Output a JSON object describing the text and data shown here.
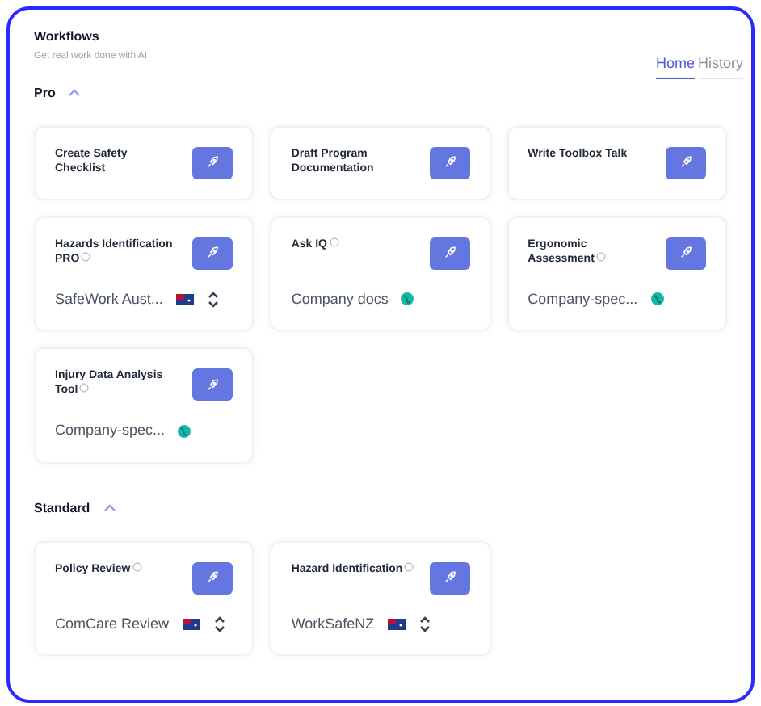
{
  "header": {
    "title": "Workflows",
    "subtitle": "Get real work done with AI"
  },
  "tabs": [
    {
      "label": "Home",
      "selected": true
    },
    {
      "label": "History",
      "selected": false
    }
  ],
  "sections": [
    {
      "title": "Pro",
      "expanded": true,
      "cards": [
        {
          "title": "Create Safety Checklist",
          "info": false
        },
        {
          "title": "Draft Program Documentation",
          "info": false
        },
        {
          "title": "Write Toolbox Talk",
          "info": false
        },
        {
          "title": "Hazards Identification PRO",
          "info": true,
          "source": {
            "kind": "flag-select",
            "label": "SafeWork Aust..."
          }
        },
        {
          "title": "Ask IQ",
          "info": true,
          "source": {
            "kind": "globe",
            "label": "Company docs"
          }
        },
        {
          "title": "Ergonomic Assessment",
          "info": true,
          "source": {
            "kind": "globe",
            "label": "Company-spec..."
          }
        },
        {
          "title": "Injury Data Analysis Tool",
          "info": true,
          "source": {
            "kind": "globe",
            "label": "Company-spec..."
          }
        }
      ]
    },
    {
      "title": "Standard",
      "expanded": true,
      "cards": [
        {
          "title": "Policy Review",
          "info": true,
          "source": {
            "kind": "flag-select",
            "label": "ComCare Review"
          }
        },
        {
          "title": "Hazard Identification",
          "info": true,
          "source": {
            "kind": "flag-select",
            "label": "WorkSafeNZ"
          }
        }
      ]
    }
  ]
}
